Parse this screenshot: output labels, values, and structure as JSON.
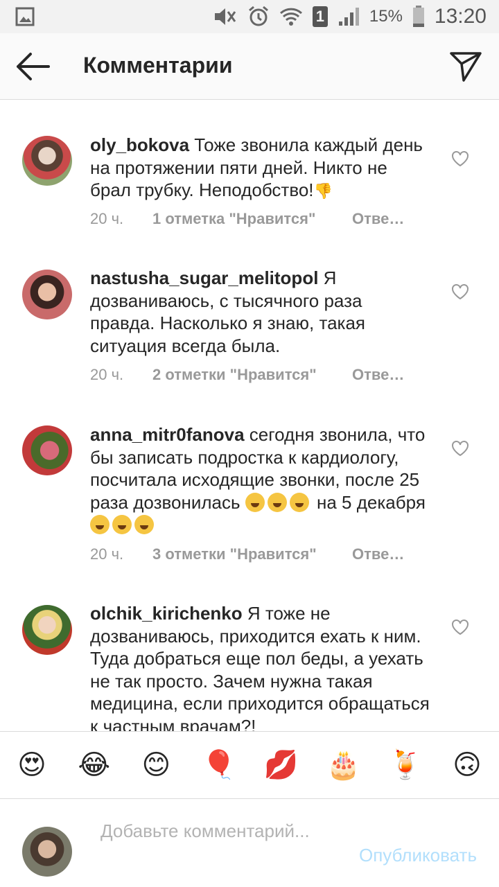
{
  "status_bar": {
    "sim": "1",
    "battery": "15%",
    "time": "13:20"
  },
  "header": {
    "title": "Комментарии"
  },
  "comments": [
    {
      "user": "oly_bokova",
      "text": "Тоже звонила каждый день на протяжении пяти дней. Никто не брал трубку. Неподобство!",
      "trail": "👎",
      "time": "20 ч.",
      "likes": "1 отметка \"Нравится\"",
      "reply": "Отве…"
    },
    {
      "user": "nastusha_sugar_melitopol",
      "text": "Я дозваниваюсь, с тысячного раза правда. Насколько я знаю, такая ситуация всегда была.",
      "time": "20 ч.",
      "likes": "2 отметки \"Нравится\"",
      "reply": "Отве…"
    },
    {
      "user": "anna_mitr0fanova",
      "text": "сегодня звонила, что бы записать подростка к кардиологу, посчитала исходящие звонки, после 25 раза дозвонилась",
      "text2": "на 5 декабря",
      "time": "20 ч.",
      "likes": "3 отметки \"Нравится\"",
      "reply": "Отве…"
    },
    {
      "user": "olchik_kirichenko",
      "text": "Я тоже не дозваниваюсь, приходится ехать к ним. Туда добраться еще пол беды, а уехать не так просто. Зачем нужна такая медицина, если приходится обращаться к частным врачам?!"
    }
  ],
  "emoji_bar": [
    "😍",
    "😂",
    "😊",
    "🎈",
    "💋",
    "🎂",
    "🍹",
    "🙃"
  ],
  "composer": {
    "placeholder": "Добавьте комментарий...",
    "publish": "Опубликовать"
  },
  "colors": {
    "accent_disabled": "#b2dffc",
    "meta": "#999999"
  }
}
